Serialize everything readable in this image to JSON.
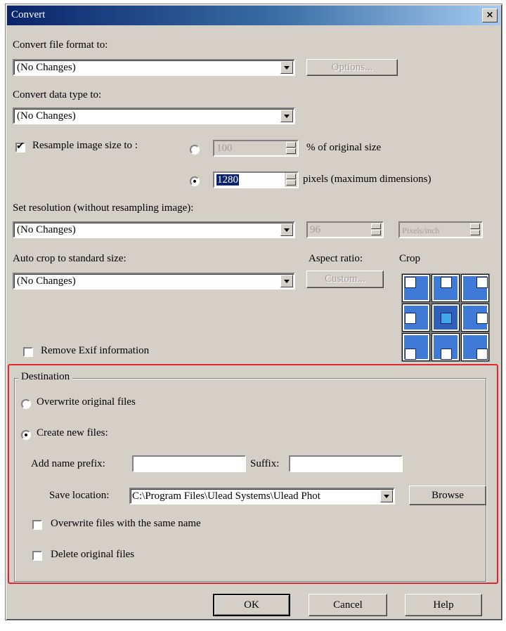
{
  "window": {
    "title": "Convert",
    "close_glyph": "×"
  },
  "format": {
    "label": "Convert file format to:",
    "label_key": "f",
    "value": "(No Changes)",
    "options_button": "Options..."
  },
  "datatype": {
    "label": "Convert data type to:",
    "value": "(No Changes)"
  },
  "resample": {
    "checkbox_label": "Resample image size to :",
    "checked": true,
    "percent_value": "100",
    "percent_unit": "% of original size",
    "pixels_value": "1280",
    "pixels_unit": "pixels (maximum dimensions)"
  },
  "resolution": {
    "label": "Set resolution (without resampling image):",
    "value": "(No Changes)",
    "dpi_value": "96",
    "unit_value": "Pixels/inch"
  },
  "autocrop": {
    "label": "Auto crop to standard size:",
    "value": "(No Changes)",
    "aspect_label": "Aspect ratio:",
    "custom_button": "Custom...",
    "crop_label": "Crop"
  },
  "exif": {
    "label": "Remove Exif information",
    "checked": false
  },
  "destination": {
    "group_label": "Destination",
    "overwrite_label": "Overwrite original files",
    "create_label": "Create new files:",
    "prefix_label": "Add name prefix:",
    "suffix_label": "Suffix:",
    "save_location_label": "Save location:",
    "save_location_value": "C:\\Program Files\\Ulead Systems\\Ulead Phot",
    "browse_button": "Browse",
    "overwrite_same_label": "Overwrite files with the same name",
    "delete_original_label": "Delete original files"
  },
  "buttons": {
    "ok": "OK",
    "cancel": "Cancel",
    "help": "Help"
  }
}
